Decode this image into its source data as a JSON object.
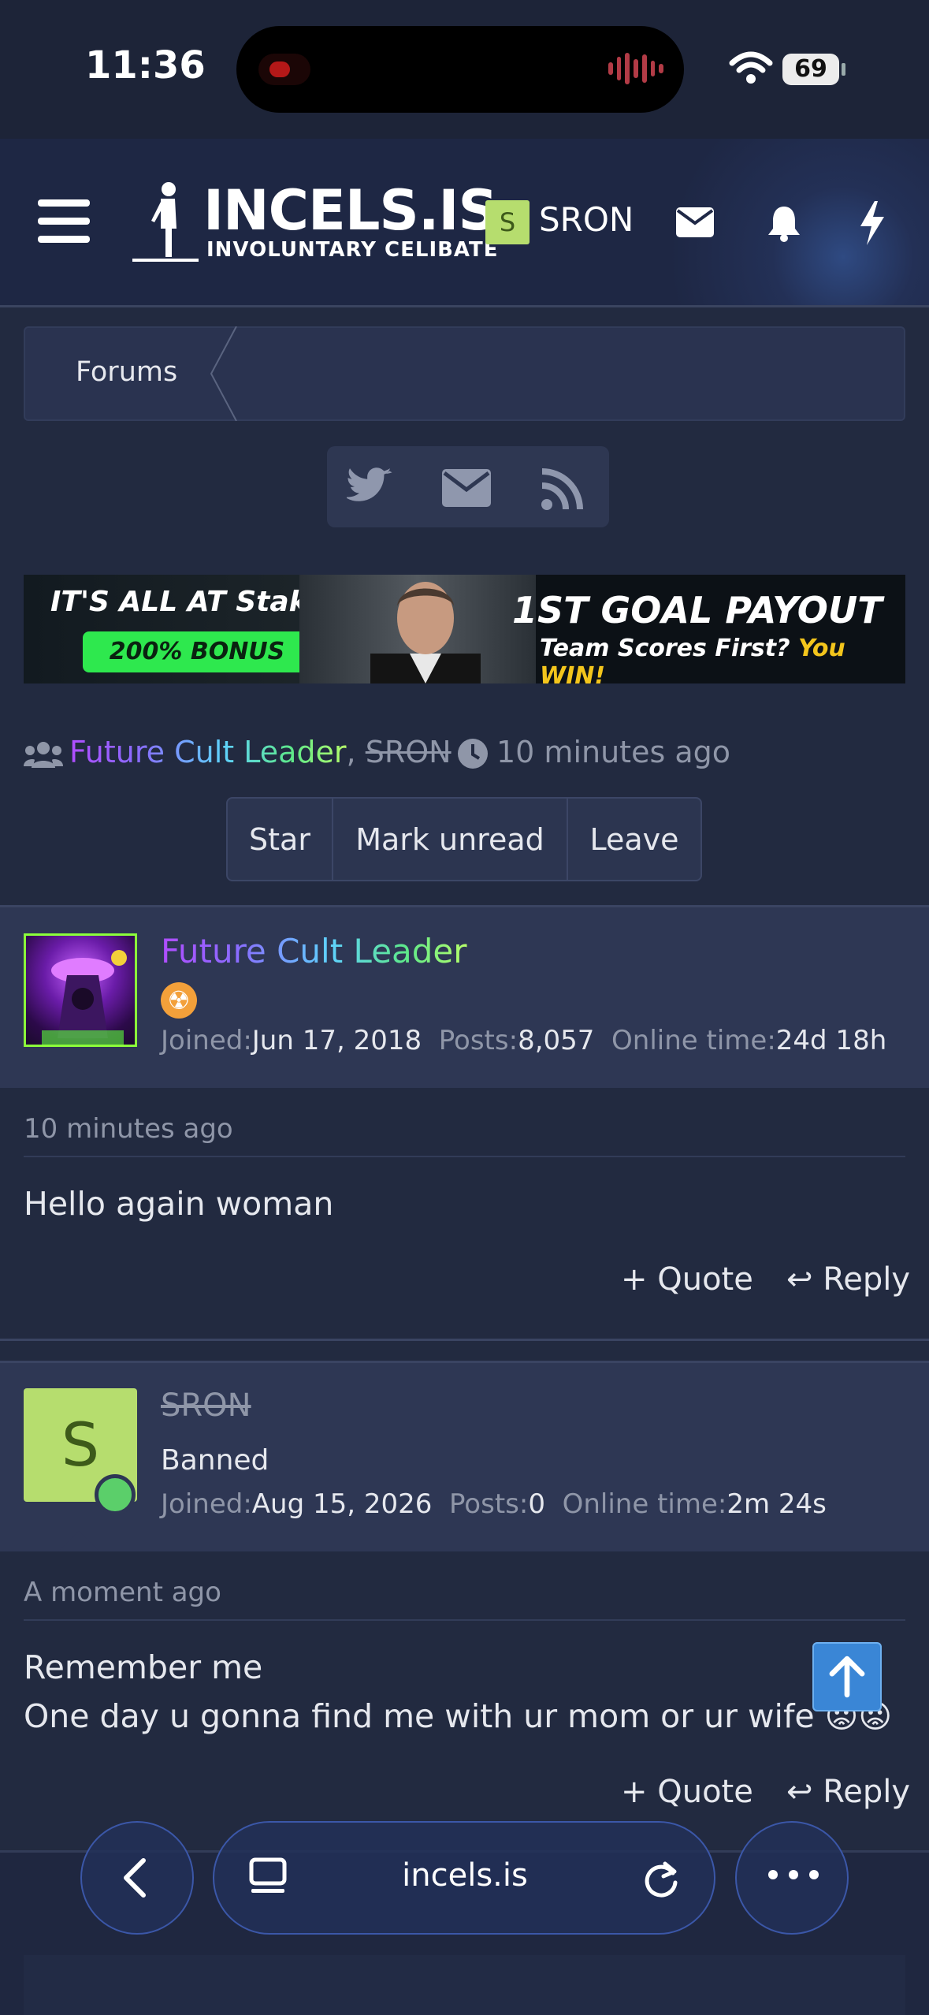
{
  "status_bar": {
    "time": "11:36",
    "battery": "69"
  },
  "header": {
    "logo_title": "INCELS.IS",
    "logo_subtitle": "INVOLUNTARY CELIBATE",
    "user_initial": "S",
    "user_name": "SRON"
  },
  "breadcrumb": {
    "forums": "Forums"
  },
  "ad": {
    "line1": "IT'S ALL AT Stake",
    "bonus": "200% BONUS",
    "headline": "1ST GOAL PAYOUT",
    "tagline_a": "Team Scores First?",
    "tagline_b": "You WIN!"
  },
  "thread": {
    "participant_1": "Future Cult Leader",
    "separator": ", ",
    "participant_2": "SRON",
    "dot": " · ",
    "time": "10 minutes ago",
    "actions": [
      "Star",
      "Mark unread",
      "Leave"
    ]
  },
  "posts": [
    {
      "author": "Future Cult Leader",
      "badge": "☢",
      "joined_label": "Joined:",
      "joined": "Jun 17, 2018",
      "posts_label": "Posts:",
      "posts": "8,057",
      "online_label": "Online time:",
      "online": "24d 18h",
      "time": "10 minutes ago",
      "text": "Hello again woman",
      "quote": "Quote",
      "reply": "Reply"
    },
    {
      "author": "SRON",
      "initial": "S",
      "role": "Banned",
      "joined_label": "Joined:",
      "joined": "Aug 15, 2026",
      "posts_label": "Posts:",
      "posts": "0",
      "online_label": "Online time:",
      "online": "2m 24s",
      "time": "A moment ago",
      "text_line1": "Remember me",
      "text_line2": "One day u gonna find me with ur mom or ur wife",
      "emoji": "😡😡",
      "quote": "Quote",
      "reply": "Reply"
    }
  ],
  "browser": {
    "url": "incels.is"
  },
  "colors": {
    "accent": "#3a86d6",
    "online": "#5bcf6a",
    "avatar_bg": "#b6dd6e",
    "ad_green": "#2ee84e"
  }
}
